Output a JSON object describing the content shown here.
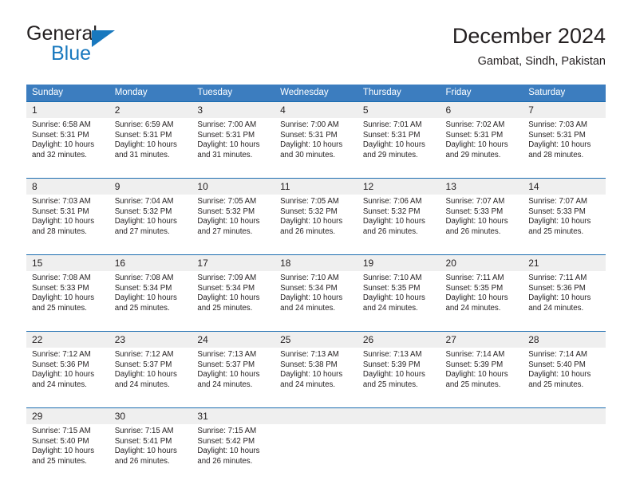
{
  "brand": {
    "name_top": "General",
    "name_bottom": "Blue",
    "accent_color": "#1878be",
    "triangle_icon": "triangle-logo-icon"
  },
  "header": {
    "title": "December 2024",
    "subtitle": "Gambat, Sindh, Pakistan"
  },
  "calendar": {
    "header_bg": "#3c7dbf",
    "daynum_bg": "#efefef",
    "row_border_color": "#1b6cb0",
    "weekdays": [
      "Sunday",
      "Monday",
      "Tuesday",
      "Wednesday",
      "Thursday",
      "Friday",
      "Saturday"
    ],
    "weeks": [
      [
        {
          "day": "1",
          "sunrise": "Sunrise: 6:58 AM",
          "sunset": "Sunset: 5:31 PM",
          "daylight_1": "Daylight: 10 hours",
          "daylight_2": "and 32 minutes."
        },
        {
          "day": "2",
          "sunrise": "Sunrise: 6:59 AM",
          "sunset": "Sunset: 5:31 PM",
          "daylight_1": "Daylight: 10 hours",
          "daylight_2": "and 31 minutes."
        },
        {
          "day": "3",
          "sunrise": "Sunrise: 7:00 AM",
          "sunset": "Sunset: 5:31 PM",
          "daylight_1": "Daylight: 10 hours",
          "daylight_2": "and 31 minutes."
        },
        {
          "day": "4",
          "sunrise": "Sunrise: 7:00 AM",
          "sunset": "Sunset: 5:31 PM",
          "daylight_1": "Daylight: 10 hours",
          "daylight_2": "and 30 minutes."
        },
        {
          "day": "5",
          "sunrise": "Sunrise: 7:01 AM",
          "sunset": "Sunset: 5:31 PM",
          "daylight_1": "Daylight: 10 hours",
          "daylight_2": "and 29 minutes."
        },
        {
          "day": "6",
          "sunrise": "Sunrise: 7:02 AM",
          "sunset": "Sunset: 5:31 PM",
          "daylight_1": "Daylight: 10 hours",
          "daylight_2": "and 29 minutes."
        },
        {
          "day": "7",
          "sunrise": "Sunrise: 7:03 AM",
          "sunset": "Sunset: 5:31 PM",
          "daylight_1": "Daylight: 10 hours",
          "daylight_2": "and 28 minutes."
        }
      ],
      [
        {
          "day": "8",
          "sunrise": "Sunrise: 7:03 AM",
          "sunset": "Sunset: 5:31 PM",
          "daylight_1": "Daylight: 10 hours",
          "daylight_2": "and 28 minutes."
        },
        {
          "day": "9",
          "sunrise": "Sunrise: 7:04 AM",
          "sunset": "Sunset: 5:32 PM",
          "daylight_1": "Daylight: 10 hours",
          "daylight_2": "and 27 minutes."
        },
        {
          "day": "10",
          "sunrise": "Sunrise: 7:05 AM",
          "sunset": "Sunset: 5:32 PM",
          "daylight_1": "Daylight: 10 hours",
          "daylight_2": "and 27 minutes."
        },
        {
          "day": "11",
          "sunrise": "Sunrise: 7:05 AM",
          "sunset": "Sunset: 5:32 PM",
          "daylight_1": "Daylight: 10 hours",
          "daylight_2": "and 26 minutes."
        },
        {
          "day": "12",
          "sunrise": "Sunrise: 7:06 AM",
          "sunset": "Sunset: 5:32 PM",
          "daylight_1": "Daylight: 10 hours",
          "daylight_2": "and 26 minutes."
        },
        {
          "day": "13",
          "sunrise": "Sunrise: 7:07 AM",
          "sunset": "Sunset: 5:33 PM",
          "daylight_1": "Daylight: 10 hours",
          "daylight_2": "and 26 minutes."
        },
        {
          "day": "14",
          "sunrise": "Sunrise: 7:07 AM",
          "sunset": "Sunset: 5:33 PM",
          "daylight_1": "Daylight: 10 hours",
          "daylight_2": "and 25 minutes."
        }
      ],
      [
        {
          "day": "15",
          "sunrise": "Sunrise: 7:08 AM",
          "sunset": "Sunset: 5:33 PM",
          "daylight_1": "Daylight: 10 hours",
          "daylight_2": "and 25 minutes."
        },
        {
          "day": "16",
          "sunrise": "Sunrise: 7:08 AM",
          "sunset": "Sunset: 5:34 PM",
          "daylight_1": "Daylight: 10 hours",
          "daylight_2": "and 25 minutes."
        },
        {
          "day": "17",
          "sunrise": "Sunrise: 7:09 AM",
          "sunset": "Sunset: 5:34 PM",
          "daylight_1": "Daylight: 10 hours",
          "daylight_2": "and 25 minutes."
        },
        {
          "day": "18",
          "sunrise": "Sunrise: 7:10 AM",
          "sunset": "Sunset: 5:34 PM",
          "daylight_1": "Daylight: 10 hours",
          "daylight_2": "and 24 minutes."
        },
        {
          "day": "19",
          "sunrise": "Sunrise: 7:10 AM",
          "sunset": "Sunset: 5:35 PM",
          "daylight_1": "Daylight: 10 hours",
          "daylight_2": "and 24 minutes."
        },
        {
          "day": "20",
          "sunrise": "Sunrise: 7:11 AM",
          "sunset": "Sunset: 5:35 PM",
          "daylight_1": "Daylight: 10 hours",
          "daylight_2": "and 24 minutes."
        },
        {
          "day": "21",
          "sunrise": "Sunrise: 7:11 AM",
          "sunset": "Sunset: 5:36 PM",
          "daylight_1": "Daylight: 10 hours",
          "daylight_2": "and 24 minutes."
        }
      ],
      [
        {
          "day": "22",
          "sunrise": "Sunrise: 7:12 AM",
          "sunset": "Sunset: 5:36 PM",
          "daylight_1": "Daylight: 10 hours",
          "daylight_2": "and 24 minutes."
        },
        {
          "day": "23",
          "sunrise": "Sunrise: 7:12 AM",
          "sunset": "Sunset: 5:37 PM",
          "daylight_1": "Daylight: 10 hours",
          "daylight_2": "and 24 minutes."
        },
        {
          "day": "24",
          "sunrise": "Sunrise: 7:13 AM",
          "sunset": "Sunset: 5:37 PM",
          "daylight_1": "Daylight: 10 hours",
          "daylight_2": "and 24 minutes."
        },
        {
          "day": "25",
          "sunrise": "Sunrise: 7:13 AM",
          "sunset": "Sunset: 5:38 PM",
          "daylight_1": "Daylight: 10 hours",
          "daylight_2": "and 24 minutes."
        },
        {
          "day": "26",
          "sunrise": "Sunrise: 7:13 AM",
          "sunset": "Sunset: 5:39 PM",
          "daylight_1": "Daylight: 10 hours",
          "daylight_2": "and 25 minutes."
        },
        {
          "day": "27",
          "sunrise": "Sunrise: 7:14 AM",
          "sunset": "Sunset: 5:39 PM",
          "daylight_1": "Daylight: 10 hours",
          "daylight_2": "and 25 minutes."
        },
        {
          "day": "28",
          "sunrise": "Sunrise: 7:14 AM",
          "sunset": "Sunset: 5:40 PM",
          "daylight_1": "Daylight: 10 hours",
          "daylight_2": "and 25 minutes."
        }
      ],
      [
        {
          "day": "29",
          "sunrise": "Sunrise: 7:15 AM",
          "sunset": "Sunset: 5:40 PM",
          "daylight_1": "Daylight: 10 hours",
          "daylight_2": "and 25 minutes."
        },
        {
          "day": "30",
          "sunrise": "Sunrise: 7:15 AM",
          "sunset": "Sunset: 5:41 PM",
          "daylight_1": "Daylight: 10 hours",
          "daylight_2": "and 26 minutes."
        },
        {
          "day": "31",
          "sunrise": "Sunrise: 7:15 AM",
          "sunset": "Sunset: 5:42 PM",
          "daylight_1": "Daylight: 10 hours",
          "daylight_2": "and 26 minutes."
        },
        {
          "day": "",
          "sunrise": "",
          "sunset": "",
          "daylight_1": "",
          "daylight_2": ""
        },
        {
          "day": "",
          "sunrise": "",
          "sunset": "",
          "daylight_1": "",
          "daylight_2": ""
        },
        {
          "day": "",
          "sunrise": "",
          "sunset": "",
          "daylight_1": "",
          "daylight_2": ""
        },
        {
          "day": "",
          "sunrise": "",
          "sunset": "",
          "daylight_1": "",
          "daylight_2": ""
        }
      ]
    ]
  }
}
